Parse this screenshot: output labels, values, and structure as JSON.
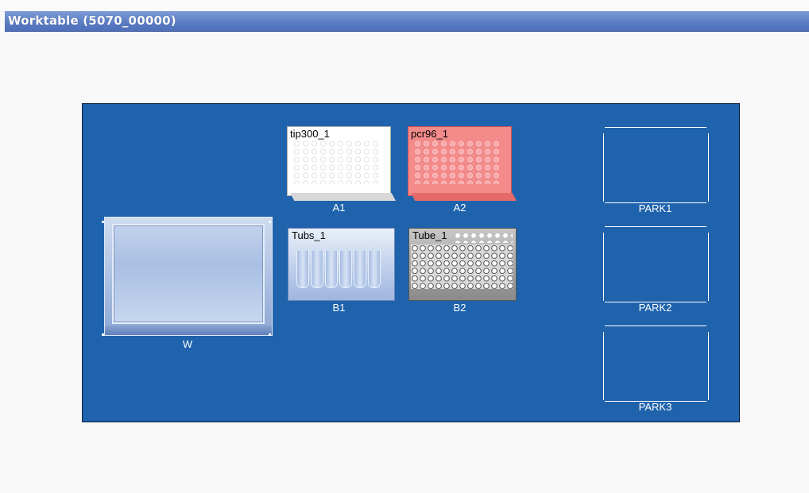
{
  "window": {
    "title": "Worktable (5070_00000)"
  },
  "positions": {
    "W": {
      "label": "W"
    },
    "A1": {
      "label": "A1",
      "labware": "tip300_1"
    },
    "A2": {
      "label": "A2",
      "labware": "pcr96_1"
    },
    "B1": {
      "label": "B1",
      "labware": "Tubs_1"
    },
    "B2": {
      "label": "B2",
      "labware": "Tube_1"
    },
    "PARK1": {
      "label": "PARK1"
    },
    "PARK2": {
      "label": "PARK2"
    },
    "PARK3": {
      "label": "PARK3"
    }
  },
  "colors": {
    "worktable": "#1f63ad",
    "title_bar": "#5a7cc4",
    "pcr_plate": "#f07a7a",
    "tip_rack": "#ffffff",
    "tube_rack": "#9a9a9a",
    "tubs_rack": "#b8cbea"
  }
}
